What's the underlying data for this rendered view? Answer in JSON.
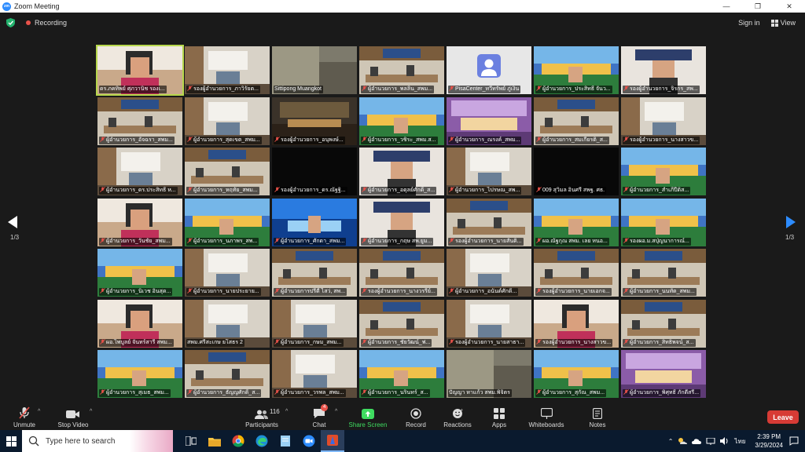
{
  "window": {
    "title": "Zoom Meeting",
    "controls": [
      "—",
      "❐",
      "✕"
    ]
  },
  "topbar": {
    "recording_label": "Recording",
    "sign_in": "Sign in",
    "view": "View"
  },
  "pagination": {
    "left": "1/3",
    "right": "1/3"
  },
  "colors": {
    "accent": "#2d8cff",
    "active_speaker": "#b7d74c",
    "muted": "#e8524a",
    "leave": "#d73b35",
    "share": "#3fdc60"
  },
  "tiles": [
    {
      "name": "ดร.ภคทิพย์ ศุภวานิช รองเ...",
      "active": true,
      "muted": false,
      "scene": "face"
    },
    {
      "name": "รองผู้อำนวยการ_ภาวิรัยต...",
      "muted": true,
      "scene": "office"
    },
    {
      "name": "Sittipong Muangkot",
      "muted": false,
      "scene": "blur"
    },
    {
      "name": "ผู้อำนวยการ_พลลิ้น_สพม...",
      "muted": true,
      "scene": "meet"
    },
    {
      "name": "PisaCenter_ทวีทรัพย์ ภู่เงิน",
      "muted": true,
      "scene": "avatar"
    },
    {
      "name": "ผู้อำนวยการ_ประสิทธิ์ จันว...",
      "muted": true,
      "scene": "banner"
    },
    {
      "name": "รองผู้อำนวยการ_จิรกร_สพ...",
      "muted": true,
      "scene": "face2"
    },
    {
      "name": "ผู้อำนวยการ_อัจฉรา_สพม...",
      "muted": true,
      "scene": "meet"
    },
    {
      "name": "ผู้อำนวยการ_สุดเขต_สพม...",
      "muted": true,
      "scene": "office"
    },
    {
      "name": "รองผู้อำนวยการ_อนุพงษ์...",
      "muted": true,
      "scene": "dark"
    },
    {
      "name": "ผู้อำนวยการ_วชิระ_สพม.ส...",
      "muted": true,
      "scene": "banner"
    },
    {
      "name": "ผู้อำนวยการ_ณรงค์_สพม...",
      "muted": true,
      "scene": "purple"
    },
    {
      "name": "ผู้อำนวยการ_สมเกียรติ_ส...",
      "muted": true,
      "scene": "meet"
    },
    {
      "name": "รองผู้อำนวยการ_นางสาวข...",
      "muted": true,
      "scene": "office"
    },
    {
      "name": "ผู้อำนวยการ_ดร.ประสิทธิ์ ห...",
      "muted": true,
      "scene": "office"
    },
    {
      "name": "ผู้อำนวยการ_หฤทัย_สพม...",
      "muted": true,
      "scene": "meet"
    },
    {
      "name": "รองผู้อำนวยการ_ดร.ณัฐฐิ...",
      "muted": true,
      "scene": "black"
    },
    {
      "name": "ผู้อำนวยการ_อดุลย์ศักดิ์_ส...",
      "muted": true,
      "scene": "face2"
    },
    {
      "name": "ผู้อำนวยการ_ไปรษณ_สพ...",
      "muted": true,
      "scene": "office"
    },
    {
      "name": "009 สุวิมล อินศรี สพฐ. ศธ.",
      "muted": true,
      "scene": "black"
    },
    {
      "name": "ผู้อำนวยการ_สำเภิ์ปีติส...",
      "muted": true,
      "scene": "banner"
    },
    {
      "name": "ผู้อำนวยการ_วันชัย_สพม...",
      "muted": true,
      "scene": "face"
    },
    {
      "name": "ผู้อำนวยการ_นภาพร_สพ...",
      "muted": true,
      "scene": "banner"
    },
    {
      "name": "ผู้อำนวยการ_ศักดา_สพม...",
      "muted": true,
      "scene": "blue"
    },
    {
      "name": "ผู้อำนวยการ_กฤษ สพ.ยูม...",
      "muted": true,
      "scene": "face2"
    },
    {
      "name": "รองผู้อำนวยการ_นายสันติ...",
      "muted": true,
      "scene": "meet"
    },
    {
      "name": "ผอ.ณัฐกุณ สพม. เลย หนอ...",
      "muted": true,
      "scene": "banner"
    },
    {
      "name": "รองผอ.ม.สปุ่ญนาการณ์...",
      "muted": true,
      "scene": "banner"
    },
    {
      "name": "ผู้อำนวยการ_นิเวช อินสุด...",
      "muted": true,
      "scene": "banner"
    },
    {
      "name": "ผู้อำนวยการ_นายประยาย...",
      "muted": true,
      "scene": "office"
    },
    {
      "name": "ผู้อำนวยการปรีดี ไสว่, สพ...",
      "muted": true,
      "scene": "meet"
    },
    {
      "name": "รองผู้อำนวยการ_นางวรรีย์...",
      "muted": true,
      "scene": "meet"
    },
    {
      "name": "ผู้อำนวยการ_อนันต์ศักดิ์...",
      "muted": true,
      "scene": "office"
    },
    {
      "name": "รองผู้อำนวยการ_นายเอกจ...",
      "muted": true,
      "scene": "meet"
    },
    {
      "name": "ผู้อำนวยการ_นนทัต_สพม...",
      "muted": true,
      "scene": "meet"
    },
    {
      "name": "ผอ.ไพบูลย์ จันทร์สารี สพม...",
      "muted": true,
      "scene": "face"
    },
    {
      "name": "สพม.ศรีสะเกษ ยโสธร 2",
      "muted": false,
      "scene": "office"
    },
    {
      "name": "ผู้อำนวยการ_กษม_สพม...",
      "muted": true,
      "scene": "office"
    },
    {
      "name": "ผู้อำนวยการ_ชัยวัฒน์_ฟ...",
      "muted": true,
      "scene": "meet"
    },
    {
      "name": "รองผู้อำนวยการ_นายสาธา...",
      "muted": true,
      "scene": "office"
    },
    {
      "name": "รองผู้อำนวยการ_นางสาวข...",
      "muted": true,
      "scene": "face"
    },
    {
      "name": "ผู้อำนวยการ_สิทธิพจน์_ส...",
      "muted": true,
      "scene": "meet"
    },
    {
      "name": "ผู้อำนวยการ_สุเมธ_สพม...",
      "muted": true,
      "scene": "banner"
    },
    {
      "name": "ผู้อำนวยการ_ธัญญศักดิ์_ส...",
      "muted": true,
      "scene": "meet"
    },
    {
      "name": "ผู้อำนวยการ_วรพล_สพม...",
      "muted": true,
      "scene": "office"
    },
    {
      "name": "ผู้อำนวยการ_นรินทร์_ส...",
      "muted": true,
      "scene": "banner"
    },
    {
      "name": "ปัญญา หาแก้ว สพม.พิจิตร",
      "muted": false,
      "scene": "blur"
    },
    {
      "name": "ผู้อำนวยการ_สุกัณ_สพม...",
      "muted": true,
      "scene": "banner"
    },
    {
      "name": "ผู้อำนวยการ_พิศุทธิ์ ภักดีสรี...",
      "muted": true,
      "scene": "purple"
    }
  ],
  "toolbar": {
    "unmute": "Unmute",
    "stop_video": "Stop Video",
    "participants": "Participants",
    "participants_count": "116",
    "chat": "Chat",
    "chat_badge": "4",
    "share_screen": "Share Screen",
    "record": "Record",
    "reactions": "Reactions",
    "apps": "Apps",
    "whiteboards": "Whiteboards",
    "notes": "Notes",
    "leave": "Leave"
  },
  "taskbar": {
    "search_placeholder": "Type here to search",
    "language": "ไทย",
    "time": "2:39 PM",
    "date": "3/29/2024"
  }
}
